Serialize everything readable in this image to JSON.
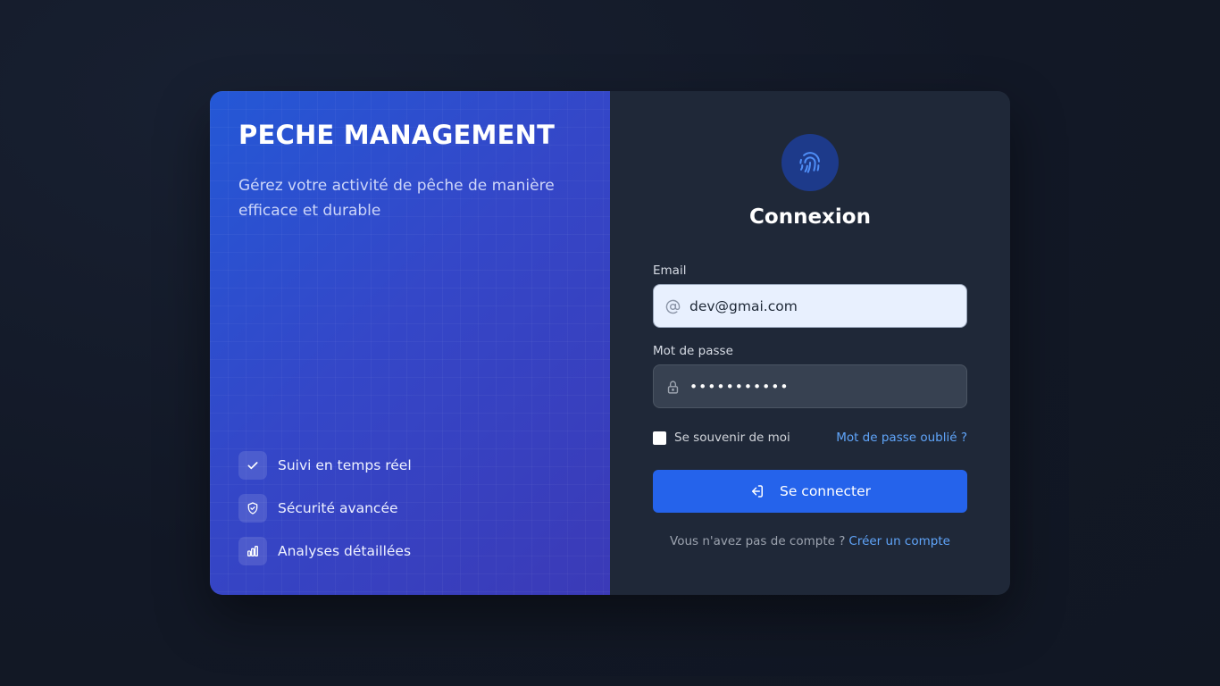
{
  "brand": {
    "title": "PECHE MANAGEMENT",
    "tagline": "Gérez votre activité de pêche de manière efficace et durable"
  },
  "features": [
    {
      "label": "Suivi en temps réel",
      "icon": "check-icon"
    },
    {
      "label": "Sécurité avancée",
      "icon": "shield-check-icon"
    },
    {
      "label": "Analyses détaillées",
      "icon": "bar-chart-icon"
    }
  ],
  "login": {
    "logo_icon": "fingerprint-icon",
    "title": "Connexion",
    "email": {
      "label": "Email",
      "value": "dev@gmai.com",
      "icon": "at-icon"
    },
    "password": {
      "label": "Mot de passe",
      "value": "•••••••••••",
      "icon": "lock-icon"
    },
    "remember_label": "Se souvenir de moi",
    "remember_checked": false,
    "forgot_label": "Mot de passe oublié ?",
    "submit_label": "Se connecter",
    "submit_icon": "login-icon",
    "signup_prompt": "Vous n'avez pas de compte ?",
    "signup_link": "Créer un compte"
  },
  "colors": {
    "accent": "#2563eb",
    "link": "#60a5fa",
    "panel_gradient_start": "#2458d6",
    "panel_gradient_end": "#3b3ab7",
    "form_bg": "#1f2838",
    "page_bg": "#121826"
  }
}
